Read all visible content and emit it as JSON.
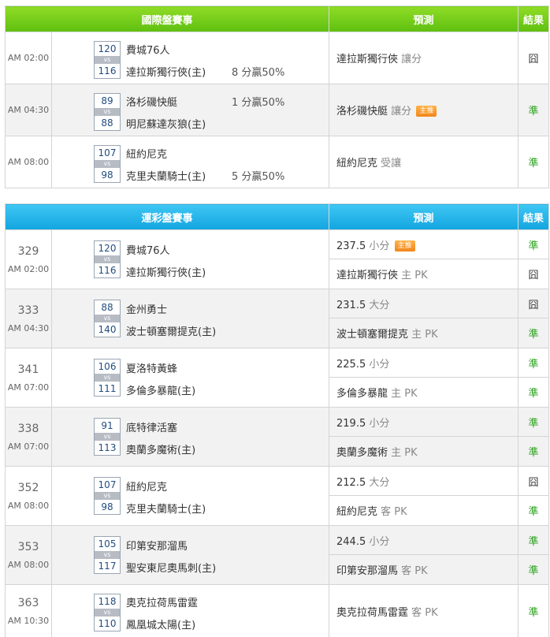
{
  "intl": {
    "header": {
      "matches": "國際盤賽事",
      "prediction": "預測",
      "result": "結果"
    },
    "games": [
      {
        "time": "AM 02:00",
        "away": "費城76人",
        "away_score": "120",
        "vs": "vs",
        "home": "達拉斯獨行俠(主)",
        "home_score": "116",
        "spread": "8 分贏50%",
        "pick": "達拉斯獨行俠",
        "pick_tag": "讓分",
        "badge": "",
        "result": "囧"
      },
      {
        "time": "AM 04:30",
        "away": "洛杉磯快艇",
        "away_score": "89",
        "vs": "vs",
        "home": "明尼蘇達灰狼(主)",
        "home_score": "88",
        "spread": "1 分贏50%",
        "pick": "洛杉磯快艇",
        "pick_tag": "讓分",
        "badge": "主推",
        "result": "準"
      },
      {
        "time": "AM 08:00",
        "away": "紐約尼克",
        "away_score": "107",
        "vs": "vs",
        "home": "克里夫蘭騎士(主)",
        "home_score": "98",
        "spread": "5 分贏50%",
        "pick": "紐約尼克",
        "pick_tag": "受讓",
        "badge": "",
        "result": "準"
      }
    ]
  },
  "lottery": {
    "header": {
      "matches": "運彩盤賽事",
      "prediction": "預測",
      "result": "結果"
    },
    "games": [
      {
        "num": "329",
        "time": "AM 02:00",
        "away": "費城76人",
        "away_score": "120",
        "vs": "vs",
        "home": "達拉斯獨行俠(主)",
        "home_score": "116",
        "total_pick": "237.5",
        "total_tag": "小分",
        "total_badge": "主推",
        "total_result": "準",
        "side_pick": "達拉斯獨行俠",
        "side_tag": "主 PK",
        "side_result": "囧"
      },
      {
        "num": "333",
        "time": "AM 04:30",
        "away": "金州勇士",
        "away_score": "88",
        "vs": "vs",
        "home": "波士頓塞爾提克(主)",
        "home_score": "140",
        "total_pick": "231.5",
        "total_tag": "大分",
        "total_badge": "",
        "total_result": "囧",
        "side_pick": "波士頓塞爾提克",
        "side_tag": "主 PK",
        "side_result": "準"
      },
      {
        "num": "341",
        "time": "AM 07:00",
        "away": "夏洛特黃蜂",
        "away_score": "106",
        "vs": "vs",
        "home": "多倫多暴龍(主)",
        "home_score": "111",
        "total_pick": "225.5",
        "total_tag": "小分",
        "total_badge": "",
        "total_result": "準",
        "side_pick": "多倫多暴龍",
        "side_tag": "主 PK",
        "side_result": "準"
      },
      {
        "num": "338",
        "time": "AM 07:00",
        "away": "底特律活塞",
        "away_score": "91",
        "vs": "vs",
        "home": "奧蘭多魔術(主)",
        "home_score": "113",
        "total_pick": "219.5",
        "total_tag": "小分",
        "total_badge": "",
        "total_result": "準",
        "side_pick": "奧蘭多魔術",
        "side_tag": "主 PK",
        "side_result": "準"
      },
      {
        "num": "352",
        "time": "AM 08:00",
        "away": "紐約尼克",
        "away_score": "107",
        "vs": "vs",
        "home": "克里夫蘭騎士(主)",
        "home_score": "98",
        "total_pick": "212.5",
        "total_tag": "大分",
        "total_badge": "",
        "total_result": "囧",
        "side_pick": "紐約尼克",
        "side_tag": "客 PK",
        "side_result": "準"
      },
      {
        "num": "353",
        "time": "AM 08:00",
        "away": "印第安那溜馬",
        "away_score": "105",
        "vs": "vs",
        "home": "聖安東尼奧馬刺(主)",
        "home_score": "117",
        "total_pick": "244.5",
        "total_tag": "小分",
        "total_badge": "",
        "total_result": "準",
        "side_pick": "印第安那溜馬",
        "side_tag": "客 PK",
        "side_result": "準"
      },
      {
        "num": "363",
        "time": "AM 10:30",
        "away": "奧克拉荷馬雷霆",
        "away_score": "118",
        "vs": "vs",
        "home": "鳳凰城太陽(主)",
        "home_score": "110",
        "side_pick": "奧克拉荷馬雷霆",
        "side_tag": "客 PK",
        "side_result": "準"
      }
    ]
  }
}
